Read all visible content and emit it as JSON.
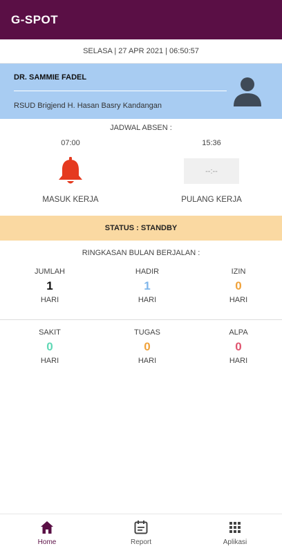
{
  "app": {
    "title": "G-SPOT"
  },
  "datetime": "SELASA | 27 APR 2021 | 06:50:57",
  "profile": {
    "name": "DR. SAMMIE FADEL",
    "hospital": "RSUD Brigjend H. Hasan Basry Kandangan",
    "avatar_icon": "person-icon"
  },
  "schedule": {
    "title": "JADWAL ABSEN :",
    "in_time": "07:00",
    "out_time": "15:36",
    "out_placeholder": "--:--",
    "in_label": "MASUK KERJA",
    "out_label": "PULANG KERJA",
    "in_icon": "bell-icon"
  },
  "status": {
    "text": "STATUS : STANDBY"
  },
  "summary": {
    "title": "RINGKASAN BULAN BERJALAN :",
    "unit": "HARI",
    "items": [
      {
        "label": "JUMLAH",
        "value": "1",
        "color": "#111111"
      },
      {
        "label": "HADIR",
        "value": "1",
        "color": "#7fb6ea"
      },
      {
        "label": "IZIN",
        "value": "0",
        "color": "#f0a23a"
      },
      {
        "label": "SAKIT",
        "value": "0",
        "color": "#5fd8b5"
      },
      {
        "label": "TUGAS",
        "value": "0",
        "color": "#f0a23a"
      },
      {
        "label": "ALPA",
        "value": "0",
        "color": "#e05570"
      }
    ]
  },
  "nav": {
    "items": [
      {
        "label": "Home",
        "icon": "home-icon",
        "active": true
      },
      {
        "label": "Report",
        "icon": "calendar-icon",
        "active": false
      },
      {
        "label": "Aplikasi",
        "icon": "apps-grid-icon",
        "active": false
      }
    ]
  },
  "colors": {
    "primary": "#5a0f45",
    "profile_bg": "#a8ccf2",
    "status_bg": "#fad9a2",
    "bell": "#e53a1f"
  }
}
